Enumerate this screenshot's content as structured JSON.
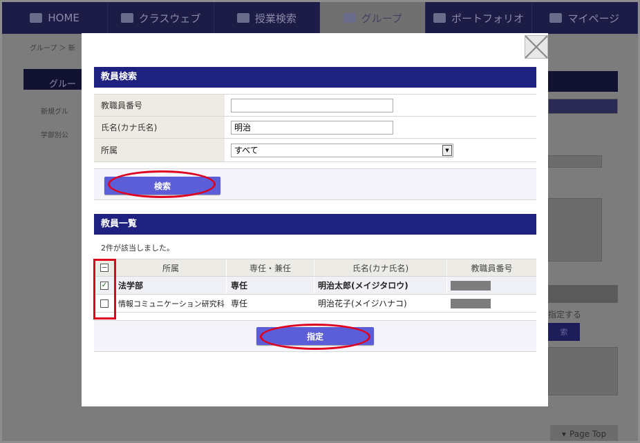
{
  "nav": {
    "items": [
      {
        "label": "HOME",
        "icon": "home-icon"
      },
      {
        "label": "クラスウェブ",
        "icon": "graduation-cap-icon"
      },
      {
        "label": "授業検索",
        "icon": "search-icon"
      },
      {
        "label": "グループ",
        "icon": "group-icon"
      },
      {
        "label": "ポートフォリオ",
        "icon": "folder-icon"
      },
      {
        "label": "マイページ",
        "icon": "smiley-icon"
      }
    ],
    "active": "グループ"
  },
  "background": {
    "breadcrumb": "グループ ＞ 新",
    "sidebar_title": "グルー",
    "sidebar_items": [
      "新規グル",
      "学部別公"
    ],
    "right_text": "指定する",
    "right_button": "索",
    "page_top": "Page Top"
  },
  "search": {
    "heading": "教員検索",
    "fields": [
      {
        "label": "教職員番号",
        "value": ""
      },
      {
        "label": "氏名(カナ氏名)",
        "value": "明治"
      },
      {
        "label": "所属",
        "value": "すべて"
      }
    ],
    "button": "検索"
  },
  "results": {
    "heading": "教員一覧",
    "count_text": "2件が該当しました。",
    "columns": [
      "所属",
      "専任・兼任",
      "氏名(カナ氏名)",
      "教職員番号"
    ],
    "rows": [
      {
        "dept": "法学部",
        "type": "専任",
        "name": "明治太郎(メイジタロウ)",
        "checked": true
      },
      {
        "dept": "情報コミュニケーション研究科",
        "type": "専任",
        "name": "明治花子(メイジハナコ)",
        "checked": false
      }
    ],
    "button": "指定"
  }
}
